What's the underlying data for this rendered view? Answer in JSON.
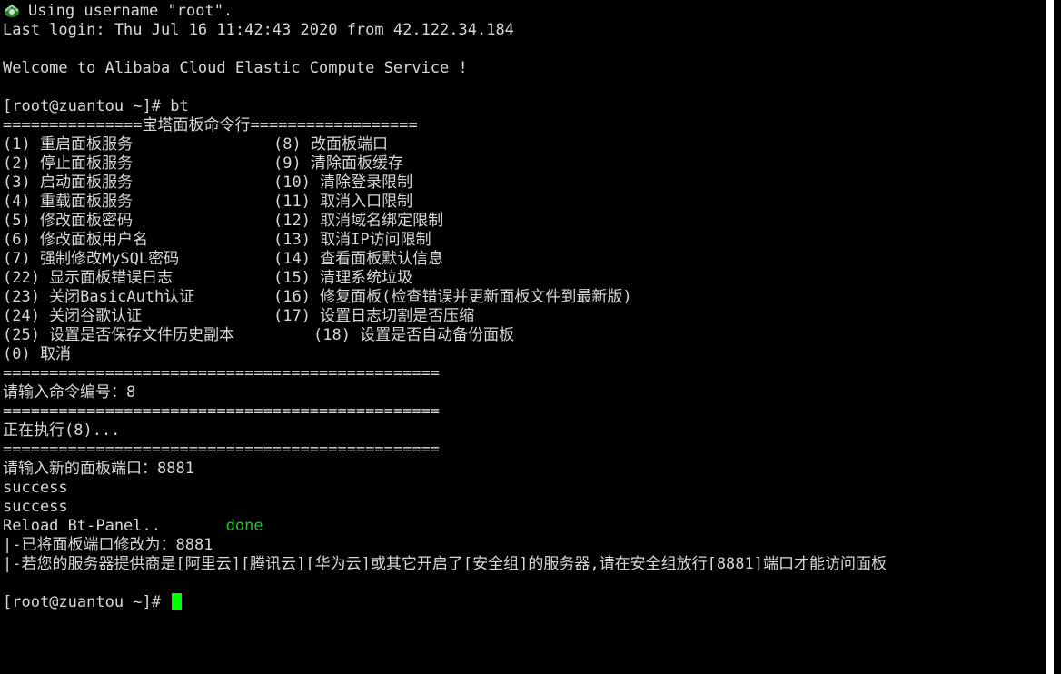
{
  "terminal": {
    "line_user": "Using username \"root\".",
    "line_last_login": "Last login: Thu Jul 16 11:42:43 2020 from 42.122.34.184",
    "line_welcome": "Welcome to Alibaba Cloud Elastic Compute Service !",
    "prompt1": "[root@zuantou ~]# bt",
    "menu_header": "===============宝塔面板命令行==================",
    "menu": [
      {
        "left": "(1) 重启面板服务",
        "right": "(8) 改面板端口"
      },
      {
        "left": "(2) 停止面板服务",
        "right": "(9) 清除面板缓存"
      },
      {
        "left": "(3) 启动面板服务",
        "right": "(10) 清除登录限制"
      },
      {
        "left": "(4) 重载面板服务",
        "right": "(11) 取消入口限制"
      },
      {
        "left": "(5) 修改面板密码",
        "right": "(12) 取消域名绑定限制"
      },
      {
        "left": "(6) 修改面板用户名",
        "right": "(13) 取消IP访问限制"
      },
      {
        "left": "(7) 强制修改MySQL密码",
        "right": "(14) 查看面板默认信息"
      },
      {
        "left": "(22) 显示面板错误日志",
        "right": "(15) 清理系统垃圾"
      },
      {
        "left": "(23) 关闭BasicAuth认证",
        "right": "(16) 修复面板(检查错误并更新面板文件到最新版)"
      },
      {
        "left": "(24) 关闭谷歌认证",
        "right": "(17) 设置日志切割是否压缩"
      },
      {
        "left": "(25) 设置是否保存文件历史副本",
        "right": "(18) 设置是否自动备份面板"
      }
    ],
    "menu_cancel": "(0) 取消",
    "separator": "===============================================",
    "input_prompt": "请输入命令编号：8",
    "executing": "正在执行(8)...",
    "new_port_prompt": "请输入新的面板端口：8881",
    "success1": "success",
    "success2": "success",
    "reload_label": "Reload Bt-Panel..",
    "reload_status": "done",
    "port_changed": "|-已将面板端口修改为：8881",
    "security_note": "|-若您的服务器提供商是[阿里云][腾讯云][华为云]或其它开启了[安全组]的服务器,请在安全组放行[8881]端口才能访问面板",
    "prompt2": "[root@zuantou ~]# "
  },
  "colors": {
    "background": "#000000",
    "text": "#d8d8d8",
    "done": "#22c722",
    "cursor": "#00ff00"
  },
  "icons": {
    "putty": "putty-icon"
  }
}
